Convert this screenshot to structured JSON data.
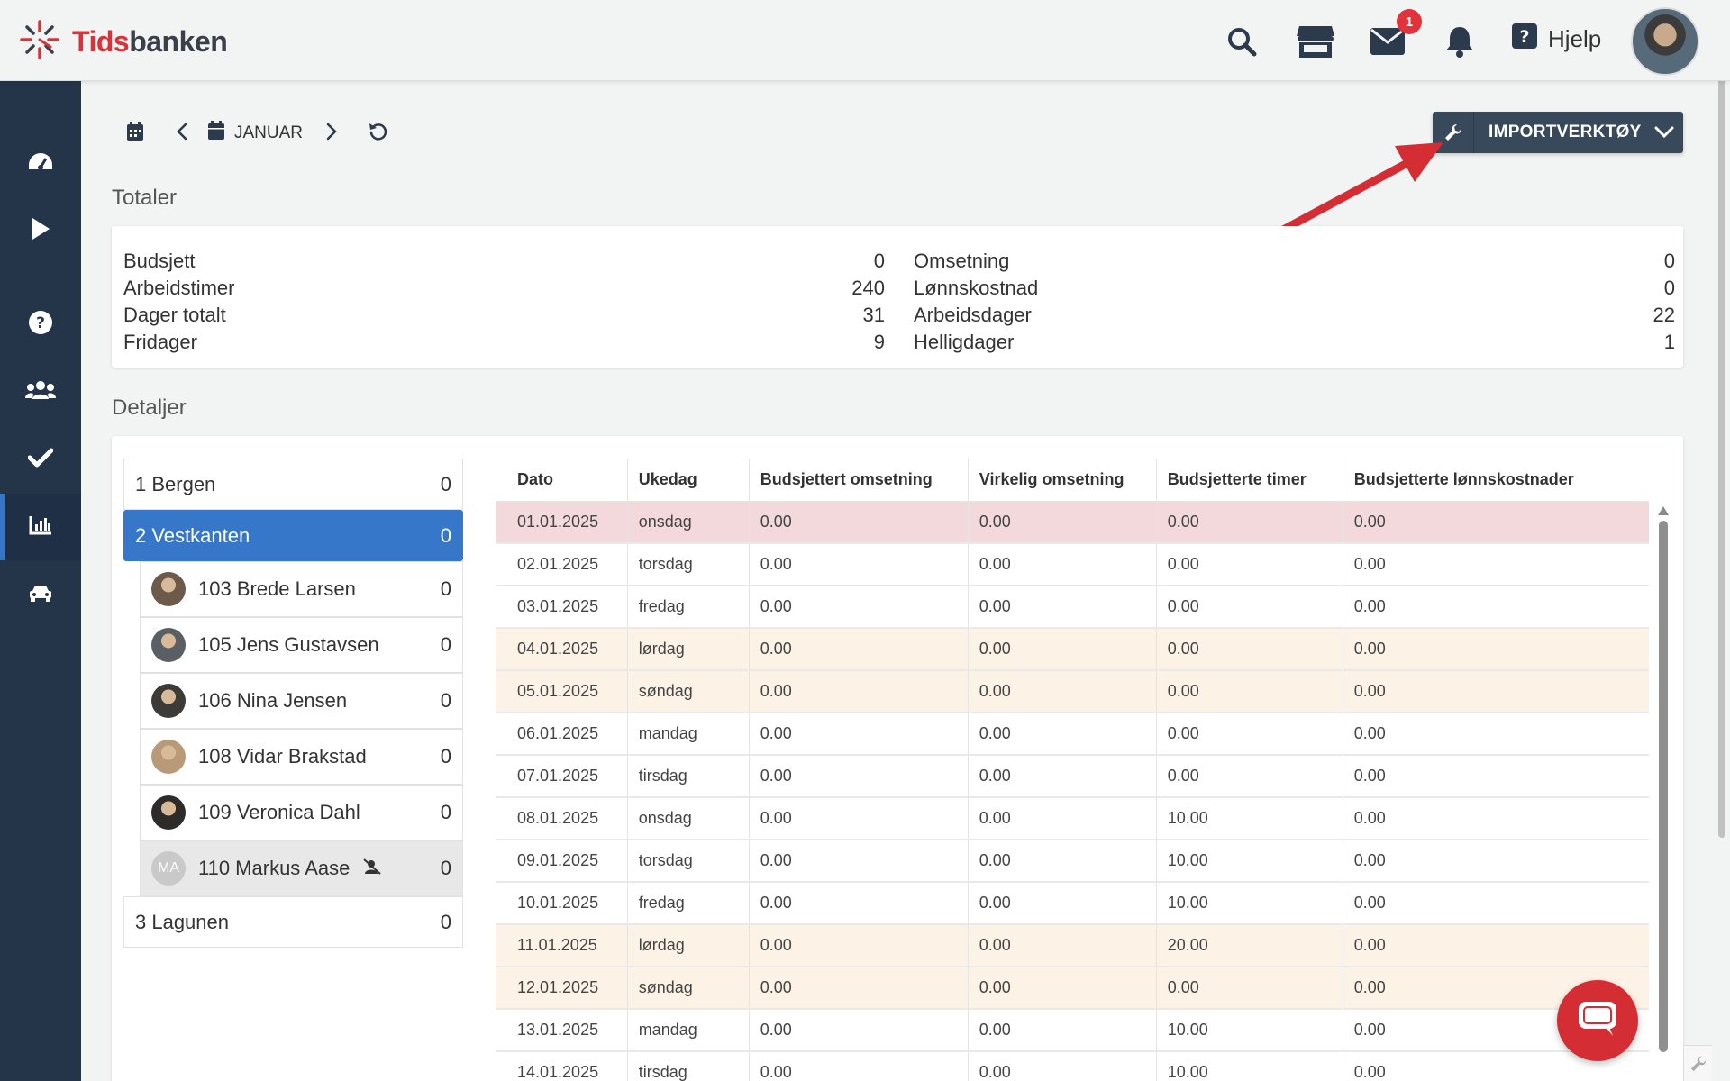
{
  "app": {
    "logo_prefix": "Tids",
    "logo_suffix": "banken",
    "help_label": "Hjelp",
    "mail_badge": "1"
  },
  "toolbar": {
    "month_label": "JANUAR",
    "import_label": "IMPORTVERKTØY"
  },
  "totals": {
    "title": "Totaler",
    "left": [
      {
        "label": "Budsjett",
        "value": "0"
      },
      {
        "label": "Arbeidstimer",
        "value": "240"
      },
      {
        "label": "Dager totalt",
        "value": "31"
      },
      {
        "label": "Fridager",
        "value": "9"
      }
    ],
    "right": [
      {
        "label": "Omsetning",
        "value": "0"
      },
      {
        "label": "Lønnskostnad",
        "value": "0"
      },
      {
        "label": "Arbeidsdager",
        "value": "22"
      },
      {
        "label": "Helligdager",
        "value": "1"
      }
    ]
  },
  "details": {
    "title": "Detaljer",
    "tree": [
      {
        "label": "1 Bergen",
        "value": "0",
        "type": "dept"
      },
      {
        "label": "2 Vestkanten",
        "value": "0",
        "type": "dept",
        "active": true
      },
      {
        "label": "103 Brede Larsen",
        "value": "0",
        "type": "person",
        "avatar": "#6d5a4a"
      },
      {
        "label": "105 Jens Gustavsen",
        "value": "0",
        "type": "person",
        "avatar": "#5a5f66"
      },
      {
        "label": "106 Nina Jensen",
        "value": "0",
        "type": "person",
        "avatar": "#3d3a3a"
      },
      {
        "label": "108 Vidar Brakstad",
        "value": "0",
        "type": "person",
        "avatar": "#b89a78"
      },
      {
        "label": "109 Veronica Dahl",
        "value": "0",
        "type": "person",
        "avatar": "#2e2b2b"
      },
      {
        "label": "110 Markus Aase",
        "value": "0",
        "type": "person",
        "initials": "MA",
        "selected": true
      },
      {
        "label": "3 Lagunen",
        "value": "0",
        "type": "dept"
      }
    ],
    "table": {
      "headers": [
        "Dato",
        "Ukedag",
        "Budsjettert omsetning",
        "Virkelig omsetning",
        "Budsjetterte timer",
        "Budsjetterte lønnskostnader"
      ],
      "rows": [
        {
          "type": "holiday",
          "cells": [
            "01.01.2025",
            "onsdag",
            "0.00",
            "0.00",
            "0.00",
            "0.00"
          ]
        },
        {
          "type": "",
          "cells": [
            "02.01.2025",
            "torsdag",
            "0.00",
            "0.00",
            "0.00",
            "0.00"
          ]
        },
        {
          "type": "",
          "cells": [
            "03.01.2025",
            "fredag",
            "0.00",
            "0.00",
            "0.00",
            "0.00"
          ]
        },
        {
          "type": "weekend",
          "cells": [
            "04.01.2025",
            "lørdag",
            "0.00",
            "0.00",
            "0.00",
            "0.00"
          ]
        },
        {
          "type": "weekend",
          "cells": [
            "05.01.2025",
            "søndag",
            "0.00",
            "0.00",
            "0.00",
            "0.00"
          ]
        },
        {
          "type": "",
          "cells": [
            "06.01.2025",
            "mandag",
            "0.00",
            "0.00",
            "0.00",
            "0.00"
          ]
        },
        {
          "type": "",
          "cells": [
            "07.01.2025",
            "tirsdag",
            "0.00",
            "0.00",
            "0.00",
            "0.00"
          ]
        },
        {
          "type": "",
          "cells": [
            "08.01.2025",
            "onsdag",
            "0.00",
            "0.00",
            "10.00",
            "0.00"
          ]
        },
        {
          "type": "",
          "cells": [
            "09.01.2025",
            "torsdag",
            "0.00",
            "0.00",
            "10.00",
            "0.00"
          ]
        },
        {
          "type": "",
          "cells": [
            "10.01.2025",
            "fredag",
            "0.00",
            "0.00",
            "10.00",
            "0.00"
          ]
        },
        {
          "type": "weekend",
          "cells": [
            "11.01.2025",
            "lørdag",
            "0.00",
            "0.00",
            "20.00",
            "0.00"
          ]
        },
        {
          "type": "weekend",
          "cells": [
            "12.01.2025",
            "søndag",
            "0.00",
            "0.00",
            "0.00",
            "0.00"
          ]
        },
        {
          "type": "",
          "cells": [
            "13.01.2025",
            "mandag",
            "0.00",
            "0.00",
            "10.00",
            "0.00"
          ]
        },
        {
          "type": "",
          "cells": [
            "14.01.2025",
            "tirsdag",
            "0.00",
            "0.00",
            "10.00",
            "0.00"
          ]
        }
      ]
    }
  },
  "colors": {
    "sidebar": "#24354a",
    "accent": "#3677c9",
    "brand_red": "#d8323a",
    "import_button": "#38495c",
    "holiday_row": "#f3d9db",
    "weekend_row": "#fdf2e6"
  },
  "icons": [
    "logo-icon",
    "search-icon",
    "store-icon",
    "mail-icon",
    "bell-icon",
    "help-icon",
    "dashboard-icon",
    "play-icon",
    "question-icon",
    "users-icon",
    "check-icon",
    "chart-icon",
    "car-icon",
    "calendar-icon",
    "chevron-left-icon",
    "calendar-month-icon",
    "chevron-right-icon",
    "reset-icon",
    "wrench-icon",
    "chevron-down-icon",
    "chat-icon"
  ]
}
